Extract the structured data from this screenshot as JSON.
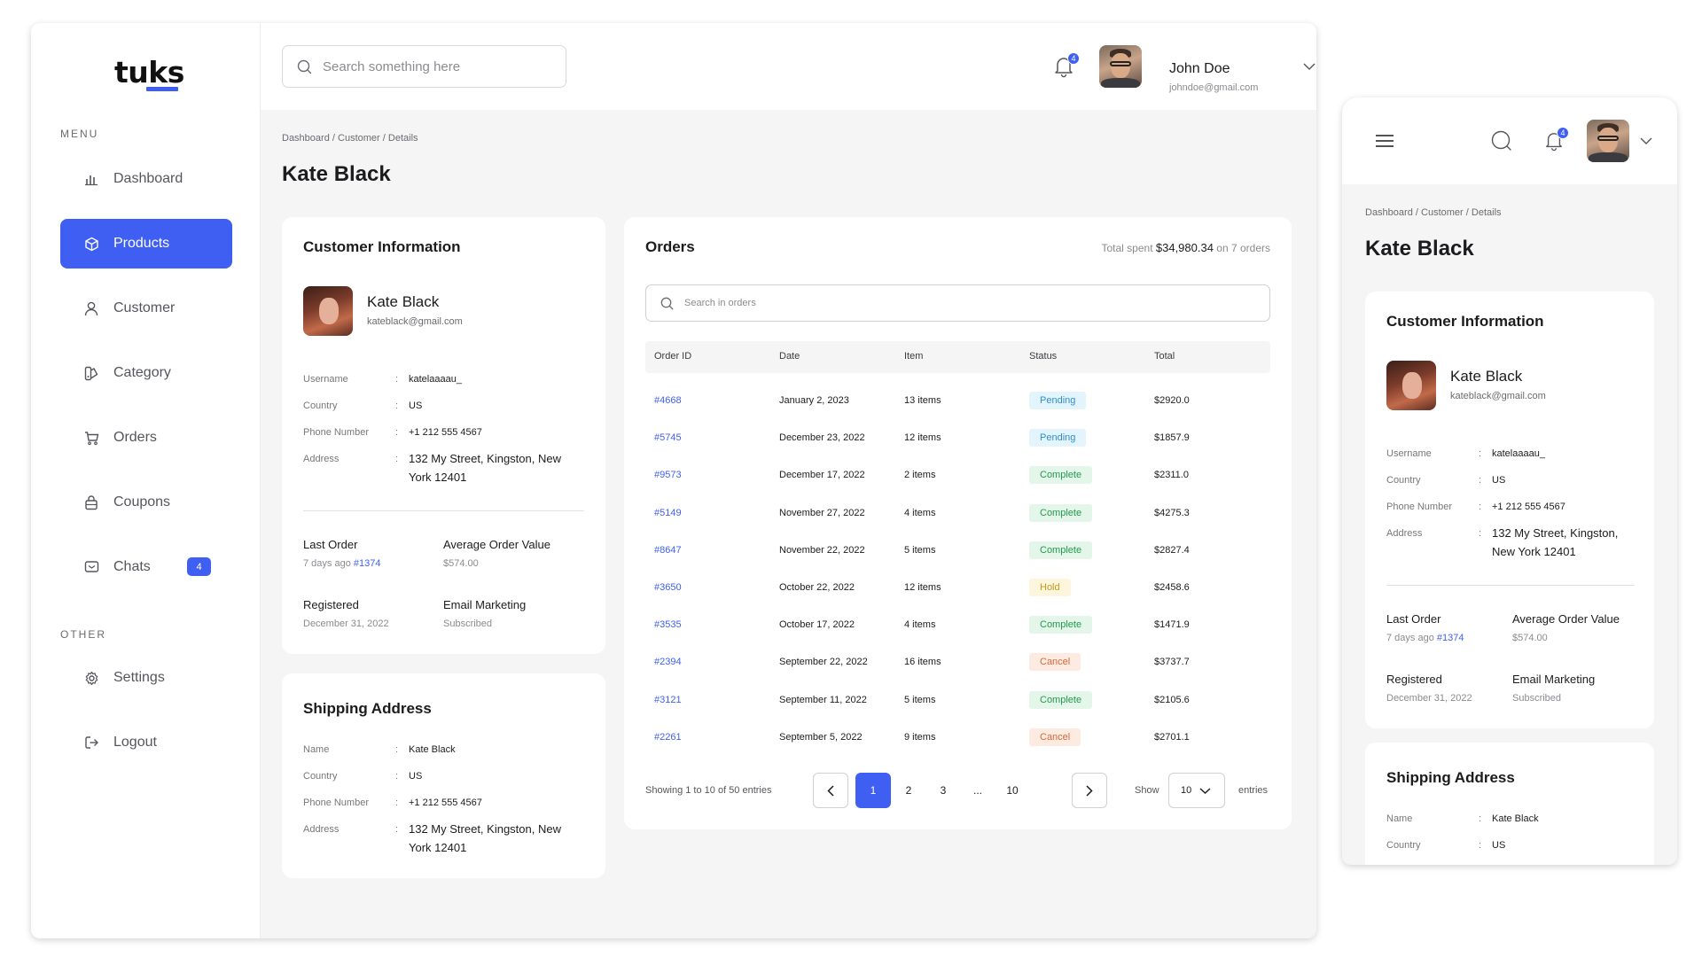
{
  "app": {
    "logo": "tuks"
  },
  "sidebar": {
    "menu_label": "MENU",
    "other_label": "OTHER",
    "items": [
      {
        "label": "Dashboard",
        "icon": "bar-chart-icon"
      },
      {
        "label": "Products",
        "icon": "box-icon",
        "active": true
      },
      {
        "label": "Customer",
        "icon": "user-icon"
      },
      {
        "label": "Category",
        "icon": "category-icon"
      },
      {
        "label": "Orders",
        "icon": "cart-icon"
      },
      {
        "label": "Coupons",
        "icon": "ticket-icon"
      },
      {
        "label": "Chats",
        "icon": "chat-icon",
        "badge": "4"
      }
    ],
    "other_items": [
      {
        "label": "Settings",
        "icon": "gear-icon"
      },
      {
        "label": "Logout",
        "icon": "logout-icon"
      }
    ]
  },
  "header": {
    "search_placeholder": "Search something here",
    "notif_count": "4",
    "user_name": "John Doe",
    "user_email": "johndoe@gmail.com"
  },
  "breadcrumb": {
    "a": "Dashboard",
    "b": "Customer",
    "c": "Details",
    "sep": "/"
  },
  "page_title": "Kate Black",
  "customer": {
    "card_title": "Customer Information",
    "name": "Kate Black",
    "email": "kateblack@gmail.com",
    "username_label": "Username",
    "username": "katelaaaau_",
    "country_label": "Country",
    "country": "US",
    "phone_label": "Phone Number",
    "phone": "+1 212 555 4567",
    "address_label": "Address",
    "address_line1": "132 My Street, Kingston, New",
    "address_line2": "York 12401",
    "address_m1": "132 My Street, Kingston,",
    "address_m2": "New York 12401",
    "colon": ":",
    "last_order_label": "Last Order",
    "last_order_ago": "7 days ago",
    "last_order_id": "#1374",
    "aov_label": "Average Order Value",
    "aov": "$574.00",
    "registered_label": "Registered",
    "registered": "December 31, 2022",
    "email_mkt_label": "Email Marketing",
    "email_mkt": "Subscribed"
  },
  "shipping": {
    "card_title": "Shipping Address",
    "name_label": "Name",
    "name": "Kate Black",
    "country_label": "Country",
    "country": "US",
    "phone_label": "Phone Number",
    "phone": "+1 212 555 4567",
    "address_label": "Address",
    "address_line1": "132 My Street, Kingston, New",
    "address_line2": "York 12401"
  },
  "orders": {
    "card_title": "Orders",
    "total_prefix": "Total spent",
    "total_amount": "$34,980.34",
    "total_suffix": "on 7 orders",
    "search_placeholder": "Search in orders",
    "columns": [
      "Order ID",
      "Date",
      "Item",
      "Status",
      "Total"
    ],
    "rows": [
      {
        "id": "#4668",
        "date": "January 2, 2023",
        "items": "13 items",
        "status": "Pending",
        "total": "$2920.0"
      },
      {
        "id": "#5745",
        "date": "December 23, 2022",
        "items": "12 items",
        "status": "Pending",
        "total": "$1857.9"
      },
      {
        "id": "#9573",
        "date": "December 17, 2022",
        "items": "2 items",
        "status": "Complete",
        "total": "$2311.0"
      },
      {
        "id": "#5149",
        "date": "November 27, 2022",
        "items": "4 items",
        "status": "Complete",
        "total": "$4275.3"
      },
      {
        "id": "#8647",
        "date": "November 22, 2022",
        "items": "5 items",
        "status": "Complete",
        "total": "$2827.4"
      },
      {
        "id": "#3650",
        "date": "October 22, 2022",
        "items": "12 items",
        "status": "Hold",
        "total": "$2458.6"
      },
      {
        "id": "#3535",
        "date": "October 17, 2022",
        "items": "4 items",
        "status": "Complete",
        "total": "$1471.9"
      },
      {
        "id": "#2394",
        "date": "September 22, 2022",
        "items": "16 items",
        "status": "Cancel",
        "total": "$3737.7"
      },
      {
        "id": "#3121",
        "date": "September 11, 2022",
        "items": "5 items",
        "status": "Complete",
        "total": "$2105.6"
      },
      {
        "id": "#2261",
        "date": "September 5, 2022",
        "items": "9 items",
        "status": "Cancel",
        "total": "$2701.1"
      }
    ],
    "showing": "Showing 1 to 10 of 50 entries",
    "pages": [
      "1",
      "2",
      "3",
      "...",
      "10"
    ],
    "current_page": "1",
    "show_label": "Show",
    "show_value": "10",
    "entries_label": "entries"
  },
  "colors": {
    "accent": "#3f5ff2",
    "pending": "#2d8fcf",
    "complete": "#249a4d",
    "hold": "#c49a19",
    "cancel": "#d4693a"
  }
}
